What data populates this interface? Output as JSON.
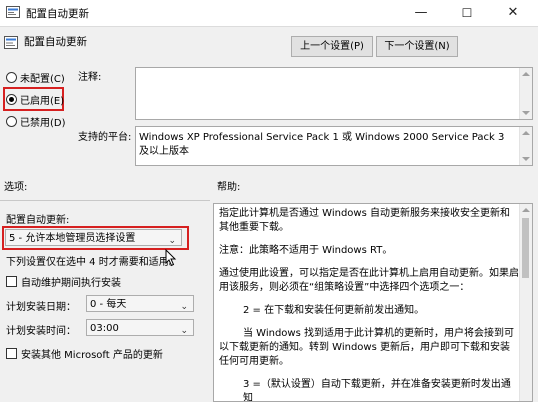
{
  "window": {
    "title": "配置自动更新",
    "controls": {
      "minimize": "—",
      "maximize": "☐",
      "close": "✕"
    }
  },
  "header": {
    "title": "配置自动更新",
    "prev_label": "上一个设置(P)",
    "next_label": "下一个设置(N)"
  },
  "radios": [
    {
      "label": "未配置(C)",
      "selected": false
    },
    {
      "label": "已启用(E)",
      "selected": true
    },
    {
      "label": "已禁用(D)",
      "selected": false
    }
  ],
  "comment": {
    "label": "注释:",
    "value": ""
  },
  "supported": {
    "label": "支持的平台:",
    "value": "Windows XP Professional Service Pack 1 或 Windows 2000 Service Pack 3 及以上版本"
  },
  "options": {
    "label": "选项:",
    "configure_label": "配置自动更新:",
    "configure_value": "5 - 允许本地管理员选择设置",
    "note": "下列设置仅在选中 4 时才需要和适用。",
    "auto_maint_label": "自动维护期间执行安装",
    "install_day_label": "计划安装日期：",
    "install_day_value": "0 - 每天",
    "install_time_label": "计划安装时间：",
    "install_time_value": "03:00",
    "other_products_label": "安装其他 Microsoft 产品的更新"
  },
  "help": {
    "label": "帮助:",
    "paragraphs": [
      "指定此计算机是否通过 Windows 自动更新服务来接收安全更新和其他重要下载。",
      "注意：此策略不适用于 Windows RT。",
      "通过使用此设置，可以指定是否在此计算机上启用自动更新。如果启用该服务，则必须在“组策略设置”中选择四个选项之一：",
      "2 = 在下载和安装任何更新前发出通知。",
      "当 Windows 找到适用于此计算机的更新时，用户将会接到可以下载更新的通知。转到 Windows 更新后，用户即可下载和安装任何可用更新。",
      "3 =（默认设置）自动下载更新，并在准备安装更新时发出通知"
    ]
  },
  "colors": {
    "highlight": "#d62020",
    "window_bg": "#f0f0f0"
  }
}
